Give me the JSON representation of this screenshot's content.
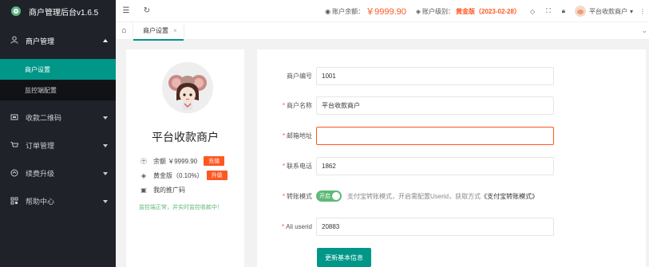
{
  "app": {
    "title": "商户管理后台v1.6.5"
  },
  "colors": {
    "accent": "#009688",
    "brand_green": "#5fb878",
    "warning": "#ff5722",
    "sidebar_bg": "#20222a"
  },
  "sidebar": {
    "groups": [
      {
        "label": "商户管理",
        "icon": "user-icon",
        "expanded": true,
        "items": [
          {
            "label": "商户设置",
            "active": true
          },
          {
            "label": "监控端配置",
            "active": false
          }
        ]
      },
      {
        "label": "收款二维码",
        "icon": "qrcode-icon"
      },
      {
        "label": "订单管理",
        "icon": "cart-icon"
      },
      {
        "label": "续费升级",
        "icon": "upgrade-icon"
      },
      {
        "label": "帮助中心",
        "icon": "help-icon"
      }
    ]
  },
  "header": {
    "balance_label": "账户余额：",
    "balance_value": "￥9999.90",
    "level_label": "账户级别：",
    "level_value": "黄金版（2023-02-28）",
    "username": "平台收款商户"
  },
  "tabs": [
    {
      "label": "商户设置",
      "active": true
    }
  ],
  "profile": {
    "name": "平台收款商户",
    "balance_text": "余额 ￥9999.90",
    "recharge_button": "充值",
    "level_text": "黄金版（0.10%）",
    "upgrade_button": "升级",
    "promo_text": "我的推广码",
    "monitor_status": "监控端正常，并实时监控收款中！"
  },
  "form": {
    "merchant_id": {
      "label": "商户编号",
      "value": "1001",
      "required": false
    },
    "merchant_name": {
      "label": "商户名称",
      "value": "平台收款商户",
      "required": true
    },
    "email": {
      "label": "邮箱地址",
      "value": "",
      "required": true
    },
    "phone": {
      "label": "联系电话",
      "value": "1862",
      "required": true
    },
    "transfer_mode": {
      "label": "转账模式",
      "required": true,
      "switch_text": "开启",
      "on": true,
      "desc": "支付宝转账模式，开启需配置Userid，获取方式",
      "desc_link": "《支付宝转账模式》"
    },
    "ali_userid": {
      "label": "Ali userid",
      "value": "20883",
      "required": true
    },
    "submit_label": "更新基本信息"
  }
}
